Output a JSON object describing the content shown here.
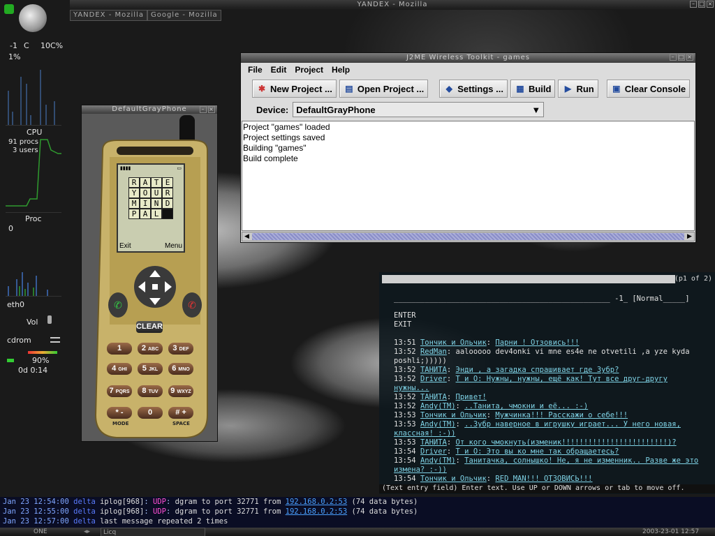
{
  "topbar": {
    "title": "YANDEX - Mozilla"
  },
  "tasks": [
    "YANDEX - Mozilla",
    "Google - Mozilla"
  ],
  "gkrellm": {
    "temp": "-1",
    "temp_unit": "C",
    "moon_pct": "10C%",
    "cpu_pct": "1%",
    "cpu_label": "CPU",
    "procs": "91 procs",
    "users": "3 users",
    "proc_label": "Proc",
    "proc_val": "0",
    "net_label": "eth0",
    "vol_label": "Vol",
    "cdrom_label": "cdrom",
    "battery_pct": "90%",
    "uptime": "0d  0:14"
  },
  "jwin": {
    "title": "J2ME Wireless Toolkit - games",
    "menu": [
      "File",
      "Edit",
      "Project",
      "Help"
    ],
    "toolbar": [
      {
        "label": "New Project ...",
        "icon": "new-project-icon",
        "glyph": "✱"
      },
      {
        "label": "Open Project ...",
        "icon": "open-project-icon",
        "glyph": "▤"
      },
      {
        "label": "Settings ...",
        "icon": "settings-icon",
        "glyph": "◆"
      },
      {
        "label": "Build",
        "icon": "build-icon",
        "glyph": "▦"
      },
      {
        "label": "Run",
        "icon": "run-icon",
        "glyph": "▶"
      },
      {
        "label": "Clear Console",
        "icon": "clear-console-icon",
        "glyph": "▣"
      }
    ],
    "device_label": "Device:",
    "device_value": "DefaultGrayPhone",
    "console": [
      "Project \"games\" loaded",
      "Project settings saved",
      "Building \"games\"",
      "Build complete"
    ]
  },
  "phone": {
    "title": "DefaultGrayPhone",
    "grid": [
      [
        "R",
        "A",
        "T",
        "E"
      ],
      [
        "Y",
        "O",
        "U",
        "R"
      ],
      [
        "M",
        "I",
        "N",
        "D"
      ],
      [
        "P",
        "A",
        "L",
        ""
      ]
    ],
    "soft_left": "Exit",
    "soft_right": "Menu",
    "clear": "CLEAR",
    "keys": [
      {
        "n": "1",
        "l": ""
      },
      {
        "n": "2",
        "l": "ABC"
      },
      {
        "n": "3",
        "l": "DEF"
      },
      {
        "n": "4",
        "l": "GHI"
      },
      {
        "n": "5",
        "l": "JKL"
      },
      {
        "n": "6",
        "l": "MNO"
      },
      {
        "n": "7",
        "l": "PQRS"
      },
      {
        "n": "8",
        "l": "TUV"
      },
      {
        "n": "9",
        "l": "WXYZ"
      },
      {
        "n": "* -",
        "l": ""
      },
      {
        "n": "0",
        "l": ""
      },
      {
        "n": "# +",
        "l": ""
      }
    ],
    "mode": "MODE",
    "space": "SPACE"
  },
  "term": {
    "page": "(p1 of 2)",
    "header": "_________________________________________________ -1_ [Normal_____]",
    "enter": "ENTER",
    "exit": "EXIT",
    "messages": [
      {
        "t": "13:51",
        "n": "Тончик и Ольчик",
        "m": "Парни ! Отзовись!!!",
        "c": true
      },
      {
        "t": "13:52",
        "n": "RedMan",
        "m": "aalooooo dev4onki vi mne es4e ne otvetili ,a yze kyda poshli;)))))",
        "c": false
      },
      {
        "t": "13:52",
        "n": "ТАНИТА",
        "m": "Энди , а загадка спрашивает где Зубр?",
        "c": true
      },
      {
        "t": "13:52",
        "n": "Driver",
        "m": "Т и О: Нужны, нужны, ещё как! Тут все друг-другу нужны...",
        "c": true
      },
      {
        "t": "13:52",
        "n": "ТАНИТА",
        "m": "Привет!",
        "c": true
      },
      {
        "t": "13:52",
        "n": "Andy(TM)",
        "m": "..Танита, чмокни и её... :-)",
        "c": true
      },
      {
        "t": "13:53",
        "n": "Тончик и Ольчик",
        "m": "Мужчинка!!! Расскажи о себе!!!",
        "c": true
      },
      {
        "t": "13:53",
        "n": "Andy(TM)",
        "m": "..Зубр наверное в игрушку играет... У него новая, классная! :-))",
        "c": true
      },
      {
        "t": "13:53",
        "n": "ТАНИТА",
        "m": "От кого чмокнуть(изменик!!!!!!!!!!!!!!!!!!!!!!!!)?",
        "c": true
      },
      {
        "t": "13:54",
        "n": "Driver",
        "m": "Т и О: Это вы ко мне так обращаетесь?",
        "c": true
      },
      {
        "t": "13:54",
        "n": "Andy(TM)",
        "m": "Танитачка, солнышко! Не, я не изменник.. Разве же это измена? :-))",
        "c": true
      },
      {
        "t": "13:54",
        "n": "Тончик и Ольчик",
        "m": "RED MAN!!! ОТЗОВИСЬ!!!",
        "c": true
      }
    ],
    "status": "(Text entry field) Enter text.  Use UP or DOWN arrows or tab to move off."
  },
  "log": [
    {
      "date": "Jan 23 12:54:00",
      "host": "delta",
      "proc": "iplog[968]",
      "proto": "UDP",
      "msg": "dgram to port 32771 from",
      "ip": "192.168.0.2:53",
      "tail": "(74 data bytes)"
    },
    {
      "date": "Jan 23 12:55:00",
      "host": "delta",
      "proc": "iplog[968]",
      "proto": "UDP",
      "msg": "dgram to port 32771 from",
      "ip": "192.168.0.2:53",
      "tail": "(74 data bytes)"
    },
    {
      "date": "Jan 23 12:57:00",
      "host": "delta",
      "proc": "",
      "proto": "",
      "msg": "last message repeated 2 times",
      "ip": "",
      "tail": ""
    }
  ],
  "bottombar": {
    "desk": "ONE",
    "task": "Licq",
    "clock": "2003-23-01 12:57"
  }
}
